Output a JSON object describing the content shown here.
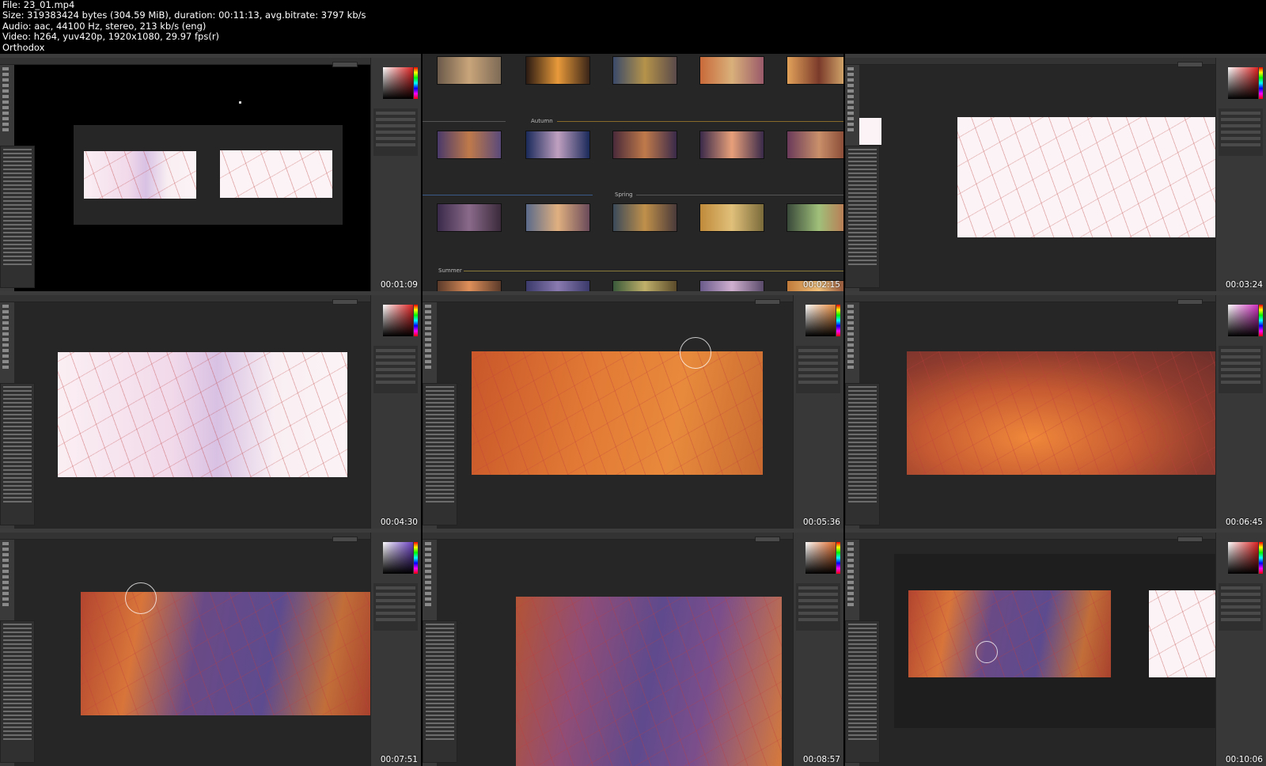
{
  "header": {
    "file": "File: 23_01.mp4",
    "size": "Size: 319383424 bytes (304.59 MiB), duration: 00:11:13, avg.bitrate: 3797 kb/s",
    "audio": "Audio: aac, 44100 Hz, stereo, 213 kb/s (eng)",
    "video": "Video: h264, yuv420p, 1920x1080, 29.97 fps(r)",
    "author": "Orthodox"
  },
  "thumbnails": [
    {
      "timestamp": "00:01:09"
    },
    {
      "timestamp": "00:02:15"
    },
    {
      "timestamp": "00:03:24"
    },
    {
      "timestamp": "00:04:30"
    },
    {
      "timestamp": "00:05:36"
    },
    {
      "timestamp": "00:06:45"
    },
    {
      "timestamp": "00:07:51"
    },
    {
      "timestamp": "00:08:57"
    },
    {
      "timestamp": "00:10:06"
    }
  ],
  "gallery": {
    "seasons": [
      "Autumn",
      "Spring",
      "Summer"
    ]
  },
  "colors": {
    "background": "#000000",
    "ps_panel": "#383838",
    "ps_canvas_bg": "#262626",
    "sketch_line": "#c0504d",
    "paint_orange": "#e27a35",
    "paint_purple": "#5d4b8f"
  },
  "icons": [
    "brush-cursor-icon",
    "mouse-cursor-icon"
  ]
}
